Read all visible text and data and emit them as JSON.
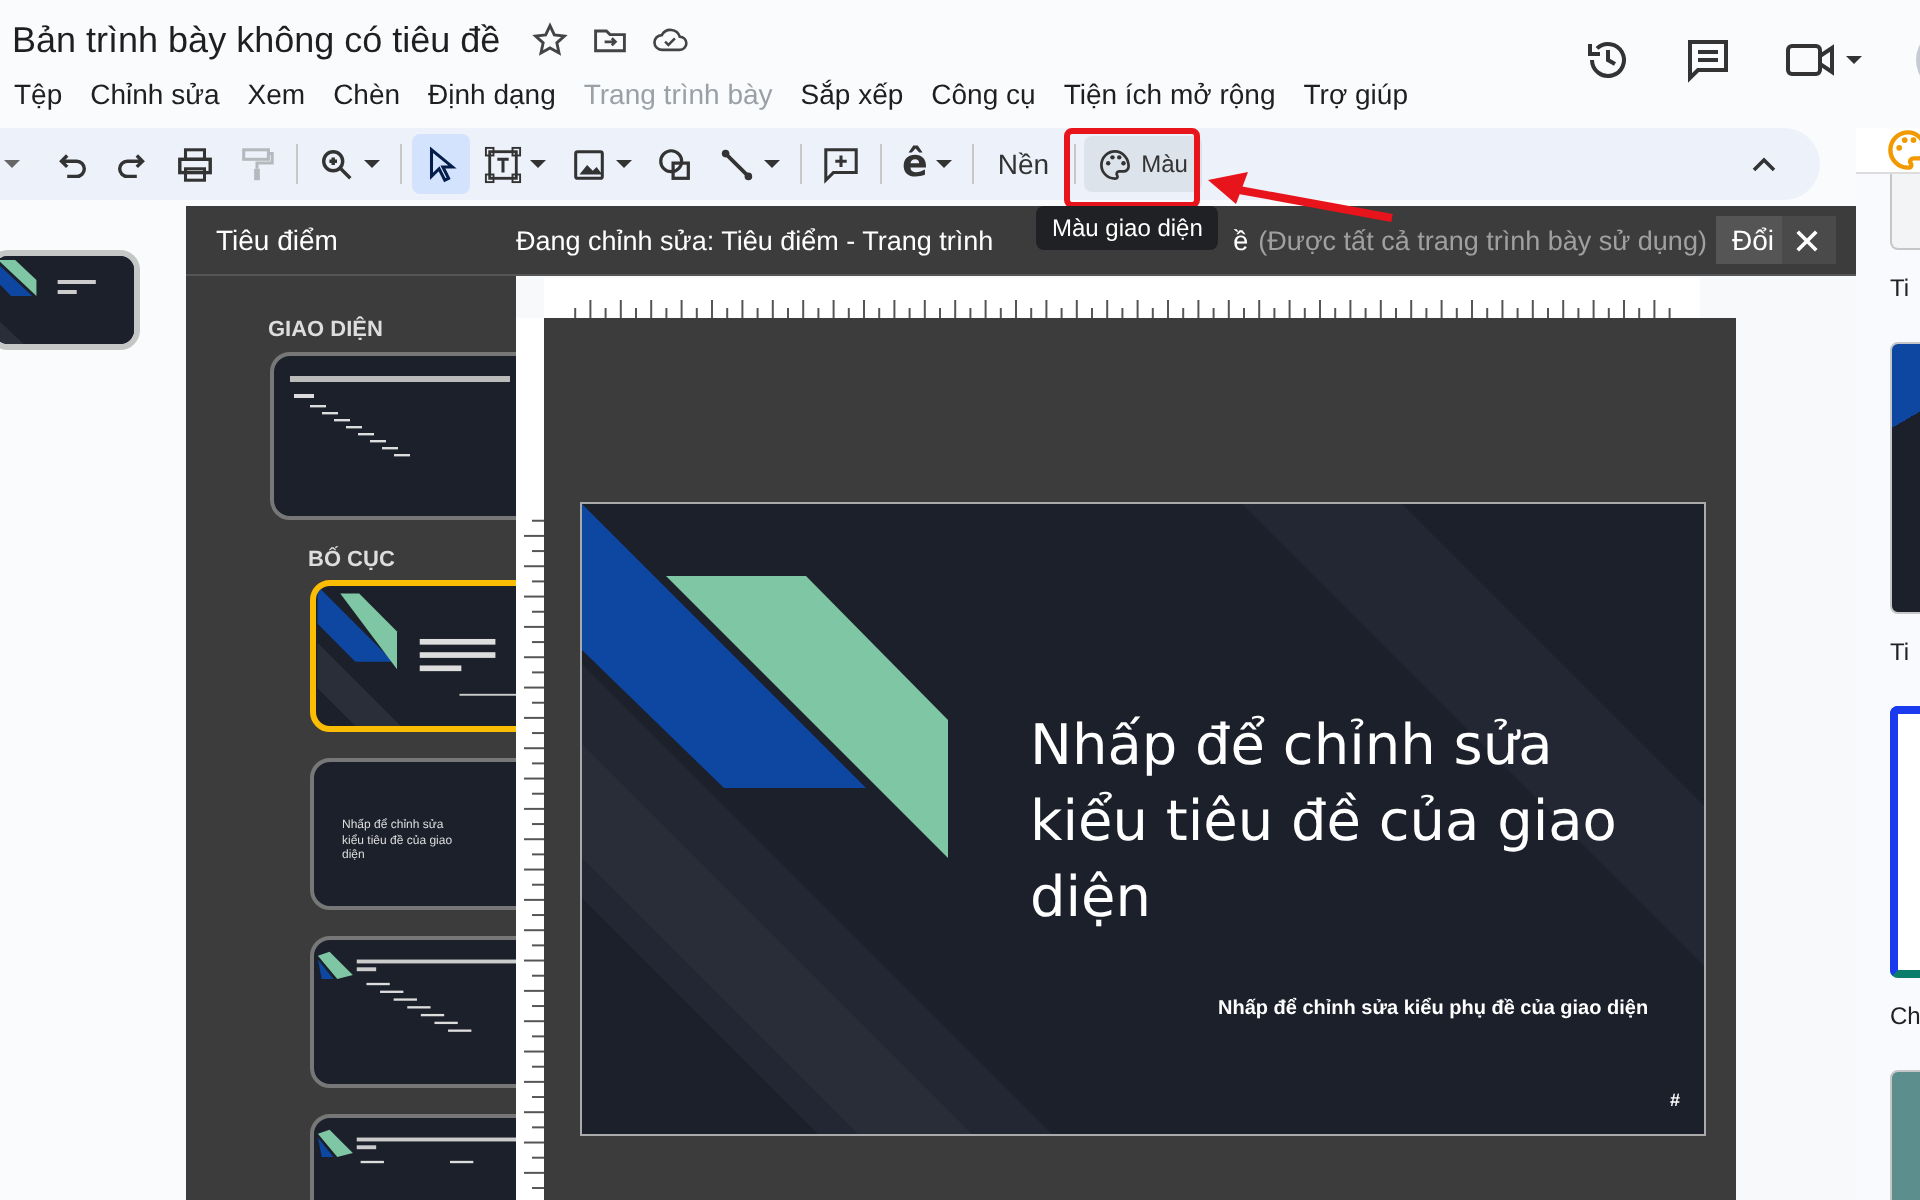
{
  "document": {
    "title": "Bản trình bày không có tiêu đề"
  },
  "menu": [
    {
      "label": "Tệp",
      "disabled": false
    },
    {
      "label": "Chỉnh sửa",
      "disabled": false
    },
    {
      "label": "Xem",
      "disabled": false
    },
    {
      "label": "Chèn",
      "disabled": false
    },
    {
      "label": "Định dạng",
      "disabled": false
    },
    {
      "label": "Trang trình bày",
      "disabled": true
    },
    {
      "label": "Sắp xếp",
      "disabled": false
    },
    {
      "label": "Công cụ",
      "disabled": false
    },
    {
      "label": "Tiện ích mở rộng",
      "disabled": false
    },
    {
      "label": "Trợ giúp",
      "disabled": false
    }
  ],
  "toolbar": {
    "tools": [
      {
        "kind": "undo",
        "selected": false,
        "disabled": false,
        "dropdown": false
      },
      {
        "kind": "redo",
        "selected": false,
        "disabled": false,
        "dropdown": false
      },
      {
        "kind": "print",
        "selected": false,
        "disabled": false,
        "dropdown": false
      },
      {
        "kind": "paint_format",
        "selected": false,
        "disabled": true,
        "dropdown": false
      },
      {
        "kind": "zoom",
        "selected": false,
        "disabled": false,
        "dropdown": true
      },
      {
        "kind": "select",
        "selected": true,
        "disabled": false,
        "dropdown": false
      },
      {
        "kind": "text_box",
        "selected": false,
        "disabled": false,
        "dropdown": true
      },
      {
        "kind": "image",
        "selected": false,
        "disabled": false,
        "dropdown": true
      },
      {
        "kind": "shape",
        "selected": false,
        "disabled": false,
        "dropdown": false
      },
      {
        "kind": "line",
        "selected": false,
        "disabled": false,
        "dropdown": true
      },
      {
        "kind": "comment",
        "selected": false,
        "disabled": false,
        "dropdown": false
      },
      {
        "kind": "input_tools",
        "glyph": "ê",
        "selected": false,
        "disabled": false,
        "dropdown": true
      }
    ],
    "background_button": "Nền",
    "theme_colors_button": {
      "label": "Màu",
      "highlighted": true
    },
    "tooltip": "Màu giao diện"
  },
  "master_editor": {
    "panel_title": "Tiêu điểm",
    "editing_title": "Đang chỉnh sửa: Tiêu điểm - Trang trình",
    "editing_title_tail": "ề",
    "usage_note": "(Được tất cả trang trình bày sử dụng)",
    "rename_button": "Đổi",
    "theme_heading": "GIAO DIỆN",
    "layouts_heading": "BỐ CỤC",
    "layouts": [
      {
        "kind": "title",
        "selected": true
      },
      {
        "kind": "section",
        "selected": false,
        "text": "Nhấp để chỉnh sửa kiểu tiêu đề của giao diện"
      },
      {
        "kind": "body",
        "selected": false
      },
      {
        "kind": "two_columns",
        "selected": false
      }
    ]
  },
  "slide": {
    "title": "Nhấp để chỉnh sửa kiểu tiêu đề của giao diện",
    "subtitle": "Nhấp để chỉnh sửa kiểu phụ đề của giao diện",
    "number": "#"
  },
  "themes_panel": {
    "themes": [
      {
        "kind": "light",
        "label": "Ti"
      },
      {
        "kind": "focus",
        "label": "Ti"
      },
      {
        "kind": "shift",
        "label": "Ch"
      },
      {
        "kind": "teal"
      }
    ]
  }
}
